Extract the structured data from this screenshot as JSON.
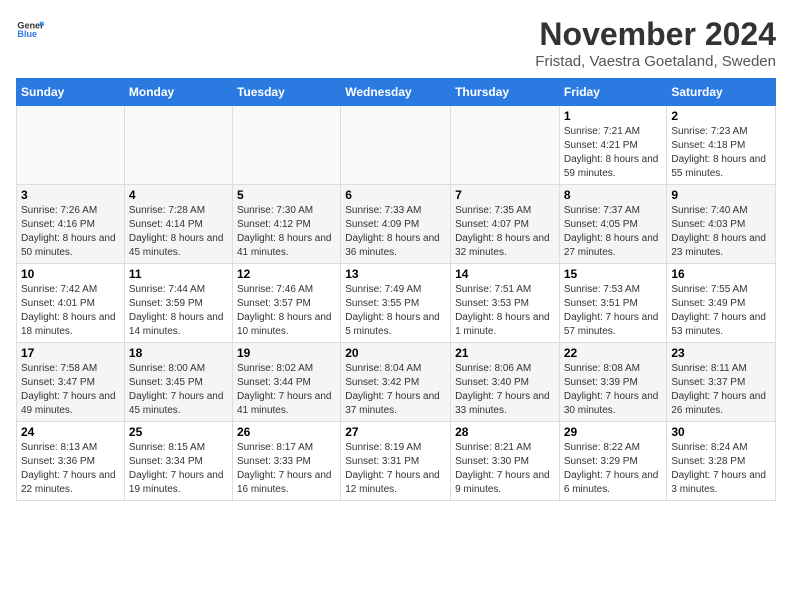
{
  "header": {
    "logo": {
      "general": "General",
      "blue": "Blue"
    },
    "title": "November 2024",
    "subtitle": "Fristad, Vaestra Goetaland, Sweden"
  },
  "calendar": {
    "weekdays": [
      "Sunday",
      "Monday",
      "Tuesday",
      "Wednesday",
      "Thursday",
      "Friday",
      "Saturday"
    ],
    "weeks": [
      [
        {
          "day": "",
          "info": ""
        },
        {
          "day": "",
          "info": ""
        },
        {
          "day": "",
          "info": ""
        },
        {
          "day": "",
          "info": ""
        },
        {
          "day": "",
          "info": ""
        },
        {
          "day": "1",
          "info": "Sunrise: 7:21 AM\nSunset: 4:21 PM\nDaylight: 8 hours and 59 minutes."
        },
        {
          "day": "2",
          "info": "Sunrise: 7:23 AM\nSunset: 4:18 PM\nDaylight: 8 hours and 55 minutes."
        }
      ],
      [
        {
          "day": "3",
          "info": "Sunrise: 7:26 AM\nSunset: 4:16 PM\nDaylight: 8 hours and 50 minutes."
        },
        {
          "day": "4",
          "info": "Sunrise: 7:28 AM\nSunset: 4:14 PM\nDaylight: 8 hours and 45 minutes."
        },
        {
          "day": "5",
          "info": "Sunrise: 7:30 AM\nSunset: 4:12 PM\nDaylight: 8 hours and 41 minutes."
        },
        {
          "day": "6",
          "info": "Sunrise: 7:33 AM\nSunset: 4:09 PM\nDaylight: 8 hours and 36 minutes."
        },
        {
          "day": "7",
          "info": "Sunrise: 7:35 AM\nSunset: 4:07 PM\nDaylight: 8 hours and 32 minutes."
        },
        {
          "day": "8",
          "info": "Sunrise: 7:37 AM\nSunset: 4:05 PM\nDaylight: 8 hours and 27 minutes."
        },
        {
          "day": "9",
          "info": "Sunrise: 7:40 AM\nSunset: 4:03 PM\nDaylight: 8 hours and 23 minutes."
        }
      ],
      [
        {
          "day": "10",
          "info": "Sunrise: 7:42 AM\nSunset: 4:01 PM\nDaylight: 8 hours and 18 minutes."
        },
        {
          "day": "11",
          "info": "Sunrise: 7:44 AM\nSunset: 3:59 PM\nDaylight: 8 hours and 14 minutes."
        },
        {
          "day": "12",
          "info": "Sunrise: 7:46 AM\nSunset: 3:57 PM\nDaylight: 8 hours and 10 minutes."
        },
        {
          "day": "13",
          "info": "Sunrise: 7:49 AM\nSunset: 3:55 PM\nDaylight: 8 hours and 5 minutes."
        },
        {
          "day": "14",
          "info": "Sunrise: 7:51 AM\nSunset: 3:53 PM\nDaylight: 8 hours and 1 minute."
        },
        {
          "day": "15",
          "info": "Sunrise: 7:53 AM\nSunset: 3:51 PM\nDaylight: 7 hours and 57 minutes."
        },
        {
          "day": "16",
          "info": "Sunrise: 7:55 AM\nSunset: 3:49 PM\nDaylight: 7 hours and 53 minutes."
        }
      ],
      [
        {
          "day": "17",
          "info": "Sunrise: 7:58 AM\nSunset: 3:47 PM\nDaylight: 7 hours and 49 minutes."
        },
        {
          "day": "18",
          "info": "Sunrise: 8:00 AM\nSunset: 3:45 PM\nDaylight: 7 hours and 45 minutes."
        },
        {
          "day": "19",
          "info": "Sunrise: 8:02 AM\nSunset: 3:44 PM\nDaylight: 7 hours and 41 minutes."
        },
        {
          "day": "20",
          "info": "Sunrise: 8:04 AM\nSunset: 3:42 PM\nDaylight: 7 hours and 37 minutes."
        },
        {
          "day": "21",
          "info": "Sunrise: 8:06 AM\nSunset: 3:40 PM\nDaylight: 7 hours and 33 minutes."
        },
        {
          "day": "22",
          "info": "Sunrise: 8:08 AM\nSunset: 3:39 PM\nDaylight: 7 hours and 30 minutes."
        },
        {
          "day": "23",
          "info": "Sunrise: 8:11 AM\nSunset: 3:37 PM\nDaylight: 7 hours and 26 minutes."
        }
      ],
      [
        {
          "day": "24",
          "info": "Sunrise: 8:13 AM\nSunset: 3:36 PM\nDaylight: 7 hours and 22 minutes."
        },
        {
          "day": "25",
          "info": "Sunrise: 8:15 AM\nSunset: 3:34 PM\nDaylight: 7 hours and 19 minutes."
        },
        {
          "day": "26",
          "info": "Sunrise: 8:17 AM\nSunset: 3:33 PM\nDaylight: 7 hours and 16 minutes."
        },
        {
          "day": "27",
          "info": "Sunrise: 8:19 AM\nSunset: 3:31 PM\nDaylight: 7 hours and 12 minutes."
        },
        {
          "day": "28",
          "info": "Sunrise: 8:21 AM\nSunset: 3:30 PM\nDaylight: 7 hours and 9 minutes."
        },
        {
          "day": "29",
          "info": "Sunrise: 8:22 AM\nSunset: 3:29 PM\nDaylight: 7 hours and 6 minutes."
        },
        {
          "day": "30",
          "info": "Sunrise: 8:24 AM\nSunset: 3:28 PM\nDaylight: 7 hours and 3 minutes."
        }
      ]
    ]
  }
}
